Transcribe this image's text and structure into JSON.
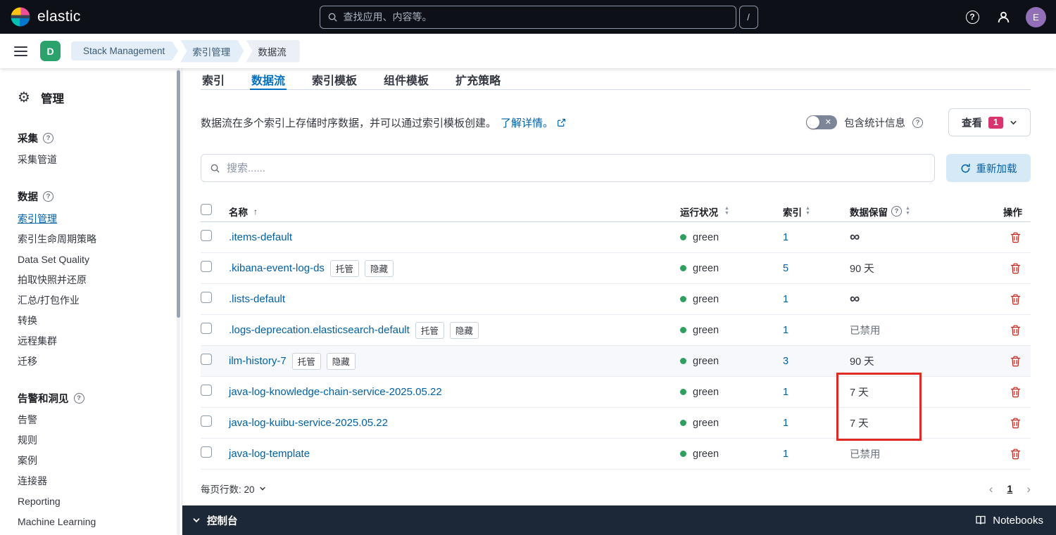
{
  "header": {
    "brand": "elastic",
    "search_placeholder": "查找应用、内容等。",
    "shortcut": "/",
    "avatar_initial": "E"
  },
  "breadcrumb_bar": {
    "space_initial": "D",
    "crumbs": [
      "Stack Management",
      "索引管理",
      "数据流"
    ]
  },
  "sidebar": {
    "title": "管理",
    "sections": [
      {
        "heading": "采集",
        "items": [
          {
            "label": "采集管道"
          }
        ]
      },
      {
        "heading": "数据",
        "items": [
          {
            "label": "索引管理"
          },
          {
            "label": "索引生命周期策略"
          },
          {
            "label": "Data Set Quality"
          },
          {
            "label": "拍取快照并还原"
          },
          {
            "label": "汇总/打包作业"
          },
          {
            "label": "转换"
          },
          {
            "label": "远程集群"
          },
          {
            "label": "迁移"
          }
        ]
      },
      {
        "heading": "告警和洞见",
        "items": [
          {
            "label": "告警"
          },
          {
            "label": "规则"
          },
          {
            "label": "案例"
          },
          {
            "label": "连接器"
          },
          {
            "label": "Reporting"
          },
          {
            "label": "Machine Learning"
          }
        ]
      }
    ]
  },
  "tabs": [
    {
      "label": "索引"
    },
    {
      "label": "数据流"
    },
    {
      "label": "索引模板"
    },
    {
      "label": "组件模板"
    },
    {
      "label": "扩充策略"
    }
  ],
  "intro": {
    "text": "数据流在多个索引上存储时序数据，并可以通过索引模板创建。",
    "link_label": "了解详情。",
    "stats_toggle_label": "包含统计信息",
    "view_button_label": "查看",
    "view_button_badge": "1"
  },
  "toolbar": {
    "search_placeholder": "搜索......",
    "reload_label": "重新加载"
  },
  "table": {
    "headers": {
      "name": "名称",
      "health": "运行状况",
      "indices": "索引",
      "retention": "数据保留",
      "actions": "操作"
    },
    "badge_managed": "托管",
    "badge_hidden": "隐藏",
    "rows": [
      {
        "name": ".items-default",
        "health": "green",
        "indices": "1",
        "retention": "∞"
      },
      {
        "name": ".kibana-event-log-ds",
        "health": "green",
        "indices": "5",
        "retention": "90 天"
      },
      {
        "name": ".lists-default",
        "health": "green",
        "indices": "1",
        "retention": "∞"
      },
      {
        "name": ".logs-deprecation.elasticsearch-default",
        "health": "green",
        "indices": "1",
        "retention": "已禁用"
      },
      {
        "name": "ilm-history-7",
        "health": "green",
        "indices": "3",
        "retention": "90 天"
      },
      {
        "name": "java-log-knowledge-chain-service-2025.05.22",
        "health": "green",
        "indices": "1",
        "retention": "7 天"
      },
      {
        "name": "java-log-kuibu-service-2025.05.22",
        "health": "green",
        "indices": "1",
        "retention": "7 天"
      },
      {
        "name": "java-log-template",
        "health": "green",
        "indices": "1",
        "retention": "已禁用"
      }
    ]
  },
  "pagination": {
    "rows_per_page": "每页行数: 20",
    "page": "1"
  },
  "console_bar": {
    "console_label": "控制台",
    "notebooks_label": "Notebooks"
  },
  "colors": {
    "link_blue": "#0061a6",
    "tab_active_blue": "#0071c2",
    "health_green": "#2f9e5f",
    "danger_red": "#bd271e",
    "view_badge_red": "#d6356e",
    "annotation_red": "#e02a24",
    "space_avatar_green": "#2ba26c",
    "user_avatar_purple": "#9170b8",
    "header_bg": "#0d1017",
    "console_bg": "#1c2837"
  }
}
